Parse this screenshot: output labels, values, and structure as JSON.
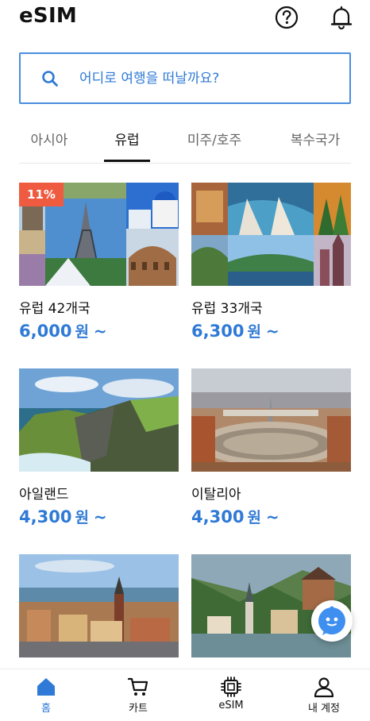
{
  "app": {
    "title": "eSIM"
  },
  "header": {
    "icons": [
      "help-circle-icon",
      "bell-icon"
    ]
  },
  "search": {
    "placeholder": "어디로 여행을 떠날까요?"
  },
  "tabs": [
    {
      "label": "아시아",
      "active": false
    },
    {
      "label": "유럽",
      "active": true
    },
    {
      "label": "미주/호주",
      "active": false
    },
    {
      "label": "복수국가",
      "active": false
    }
  ],
  "products": [
    {
      "name": "유럽 42개국",
      "price": "6,000",
      "currency": "원",
      "suffix": "~",
      "badge": "11%"
    },
    {
      "name": "유럽 33개국",
      "price": "6,300",
      "currency": "원",
      "suffix": "~"
    },
    {
      "name": "아일랜드",
      "price": "4,300",
      "currency": "원",
      "suffix": "~"
    },
    {
      "name": "이탈리아",
      "price": "4,300",
      "currency": "원",
      "suffix": "~"
    },
    {
      "name": "",
      "price": "",
      "currency": "",
      "suffix": ""
    },
    {
      "name": "",
      "price": "",
      "currency": "",
      "suffix": ""
    }
  ],
  "bottom_nav": [
    {
      "label": "홈",
      "icon": "home-icon",
      "active": true
    },
    {
      "label": "카트",
      "icon": "cart-icon",
      "active": false
    },
    {
      "label": "eSIM",
      "icon": "chip-icon",
      "active": false
    },
    {
      "label": "내 계정",
      "icon": "user-icon",
      "active": false
    }
  ],
  "colors": {
    "accent": "#2f7ad6",
    "badge": "#ef5b41",
    "text": "#111111"
  }
}
